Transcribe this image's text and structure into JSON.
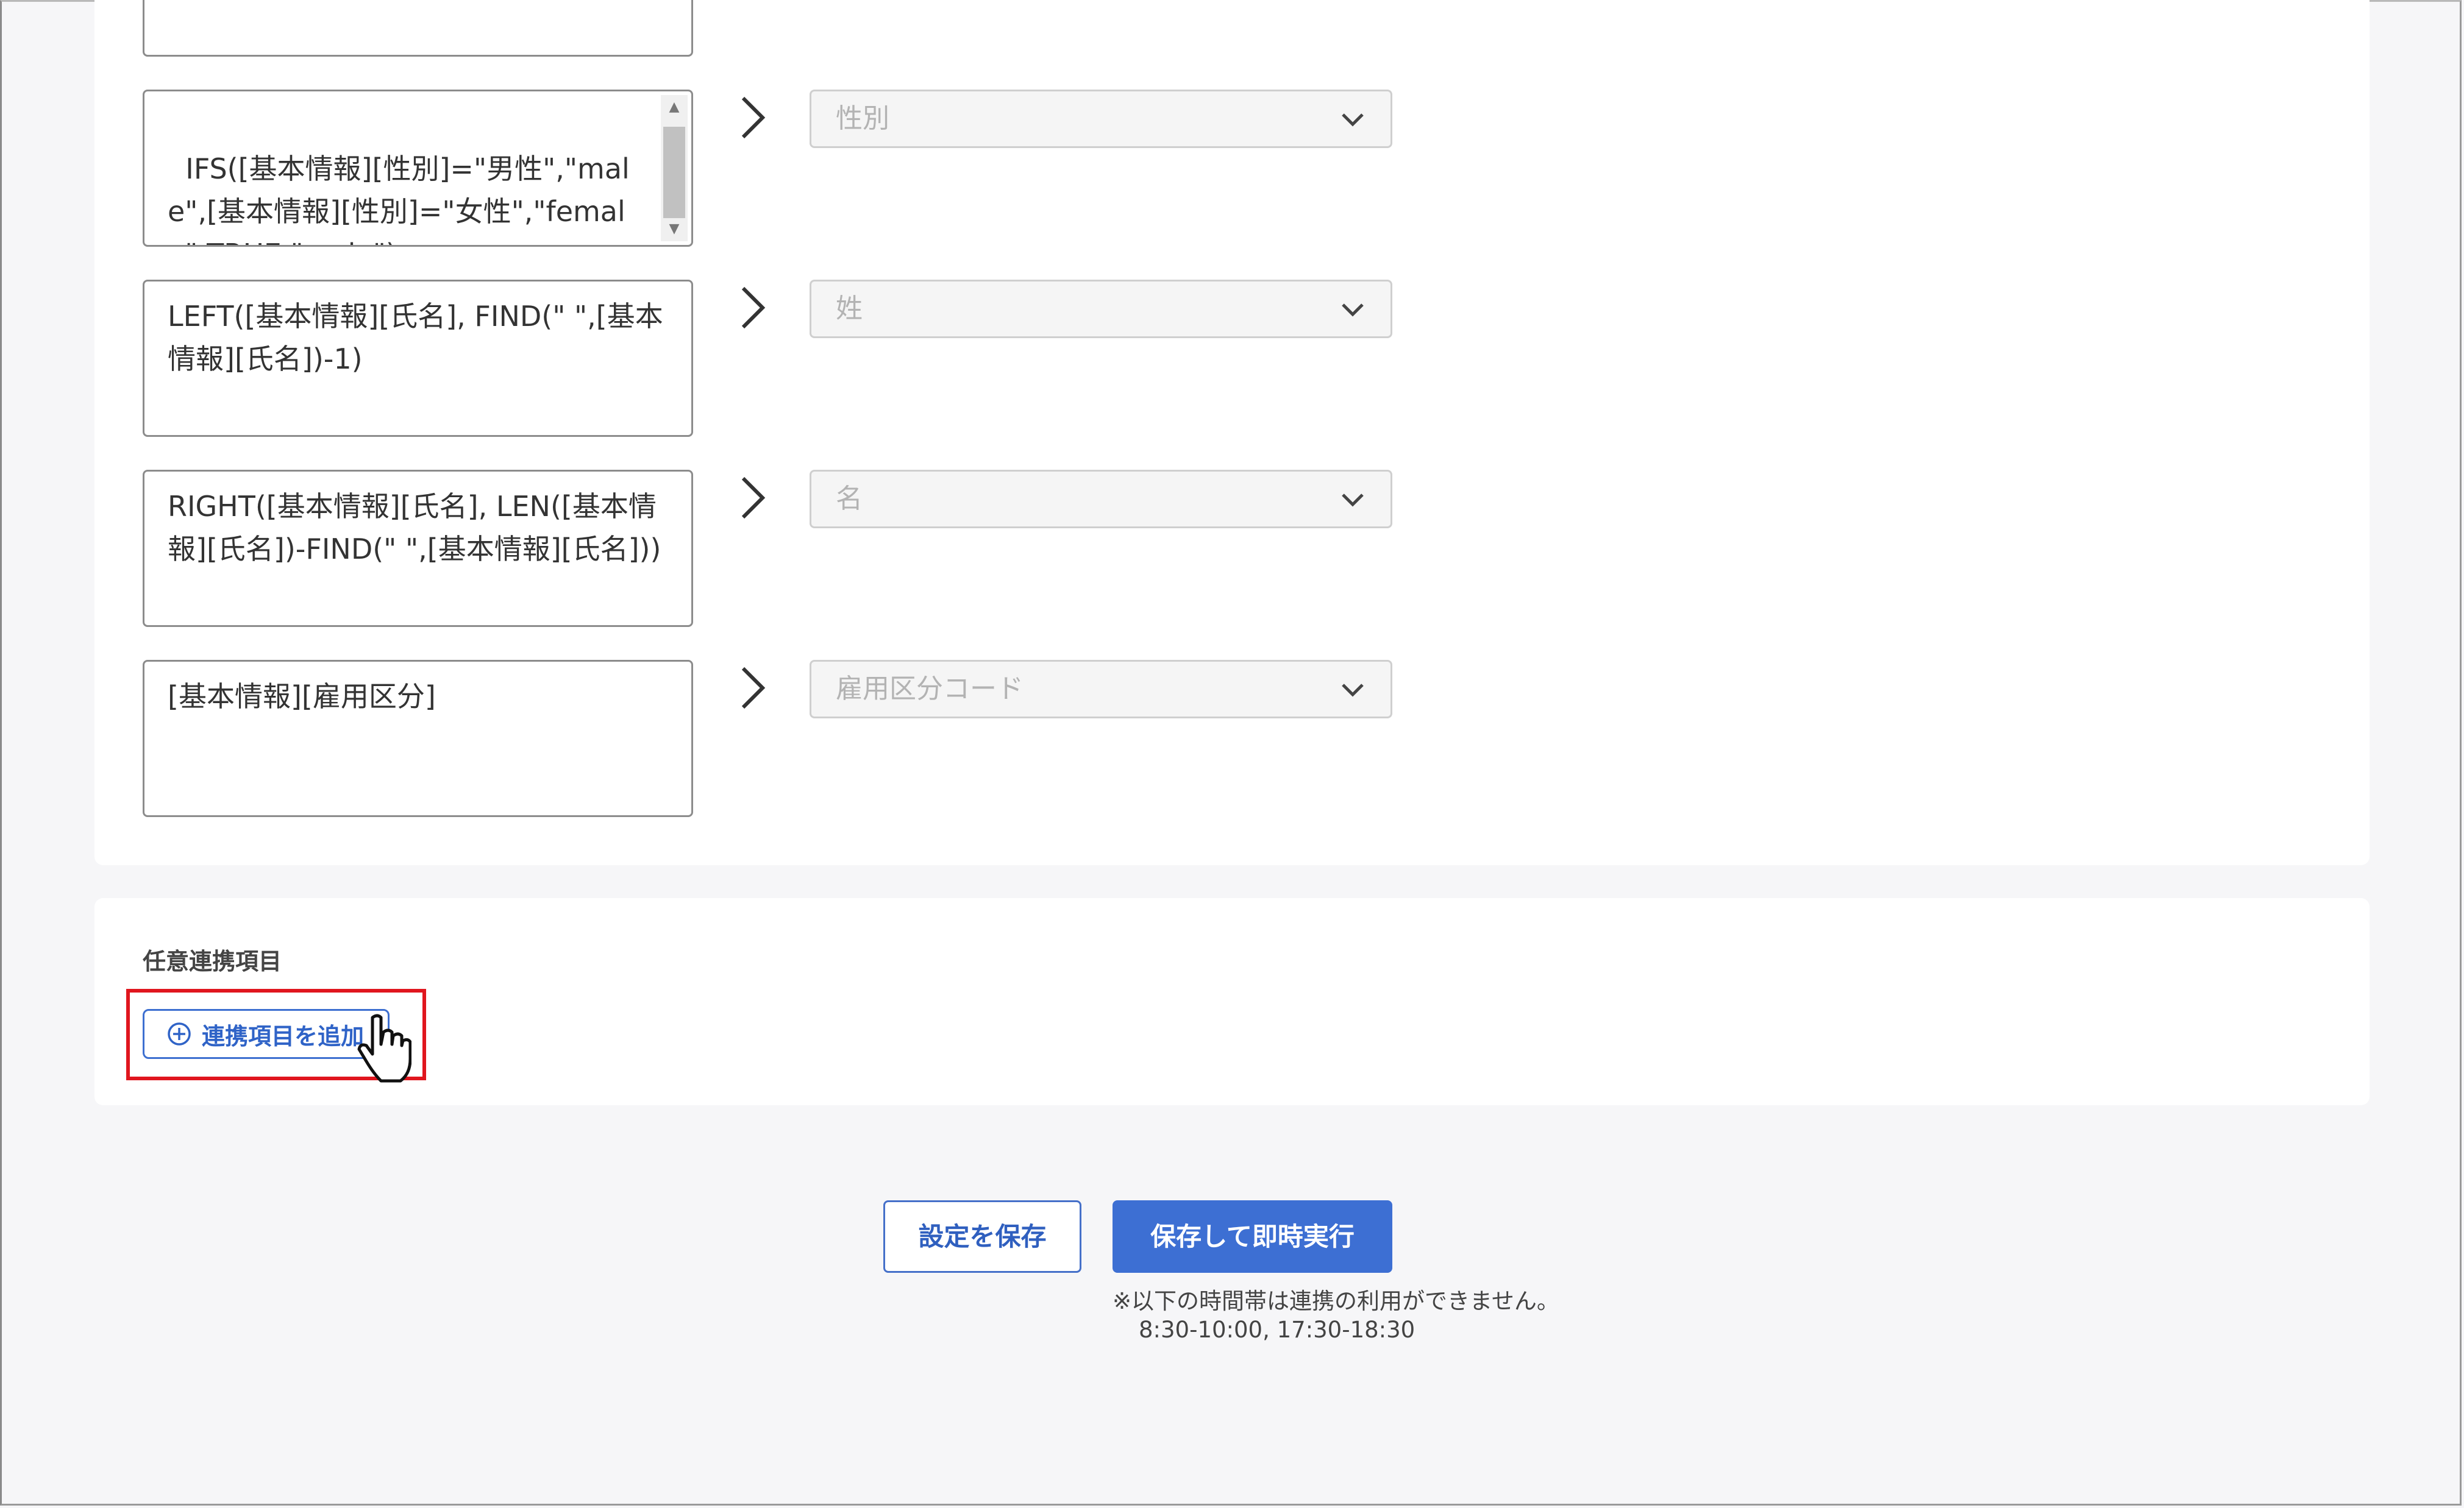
{
  "mapping_rows": [
    {
      "formula": "",
      "target": ""
    },
    {
      "formula": "IFS([基本情報][性別]=\"男性\",\"male\",[基本情報][性別]=\"女性\",\"female\",TRUE,\"male\")",
      "target": "性別"
    },
    {
      "formula": "LEFT([基本情報][氏名], FIND(\" \",[基本情報][氏名])-1)",
      "target": "姓"
    },
    {
      "formula": "RIGHT([基本情報][氏名], LEN([基本情報][氏名])-FIND(\" \",[基本情報][氏名]))",
      "target": "名"
    },
    {
      "formula": "[基本情報][雇用区分]",
      "target": "雇用区分コード"
    }
  ],
  "optional_section": {
    "title": "任意連携項目",
    "add_button_label": "連携項目を追加",
    "add_icon": "plus-circle-icon"
  },
  "actions": {
    "save_label": "設定を保存",
    "save_and_run_label": "保存して即時実行"
  },
  "notice": {
    "line1": "※以下の時間帯は連携の利用ができません。",
    "line2": "8:30-10:00, 17:30-18:30"
  },
  "colors": {
    "primary": "#3d6fd3",
    "highlight": "#e0161e",
    "page_bg": "#f6f6f8"
  }
}
